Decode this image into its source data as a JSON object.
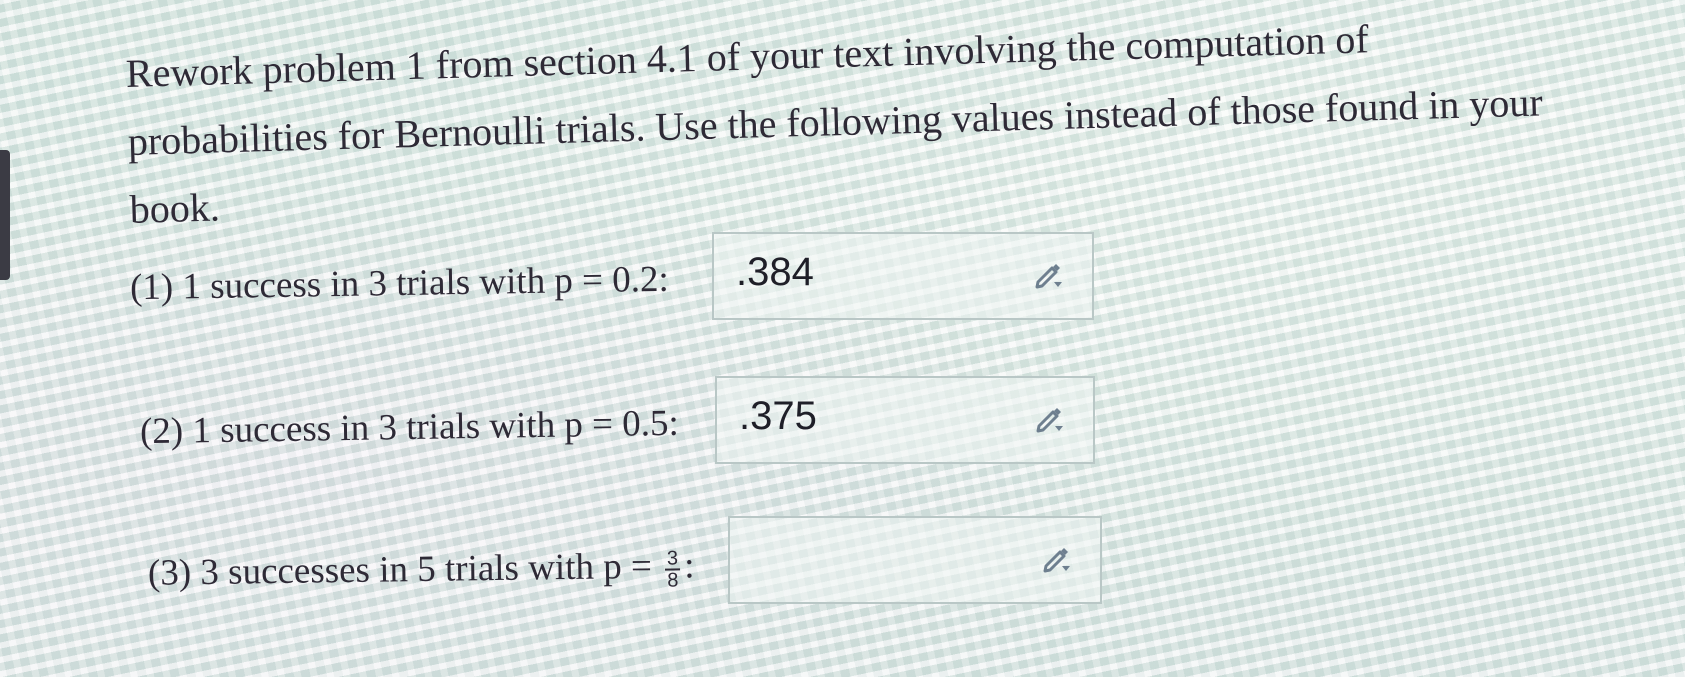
{
  "question": {
    "text": "Rework problem 1 from section 4.1 of your text involving the computation of probabilities for Bernoulli trials. Use the following values instead of those found in your book."
  },
  "items": [
    {
      "label": "(1) 1 success in 3 trials with p = 0.2:",
      "answer": ".384",
      "placeholder": ""
    },
    {
      "label": "(2) 1 success in 3 trials with p = 0.5:",
      "answer": ".375",
      "placeholder": ""
    },
    {
      "label_prefix": "(3) 3 successes in 5 trials with p =",
      "fraction_numerator": "3",
      "fraction_denominator": "8",
      "label_suffix": ":",
      "answer": "",
      "placeholder": ""
    }
  ],
  "icons": {
    "edit": "pencil-edit-icon"
  },
  "colors": {
    "text": "#2e2a36",
    "box_border": "#b9c7c6",
    "icon": "#6e7f8f"
  }
}
